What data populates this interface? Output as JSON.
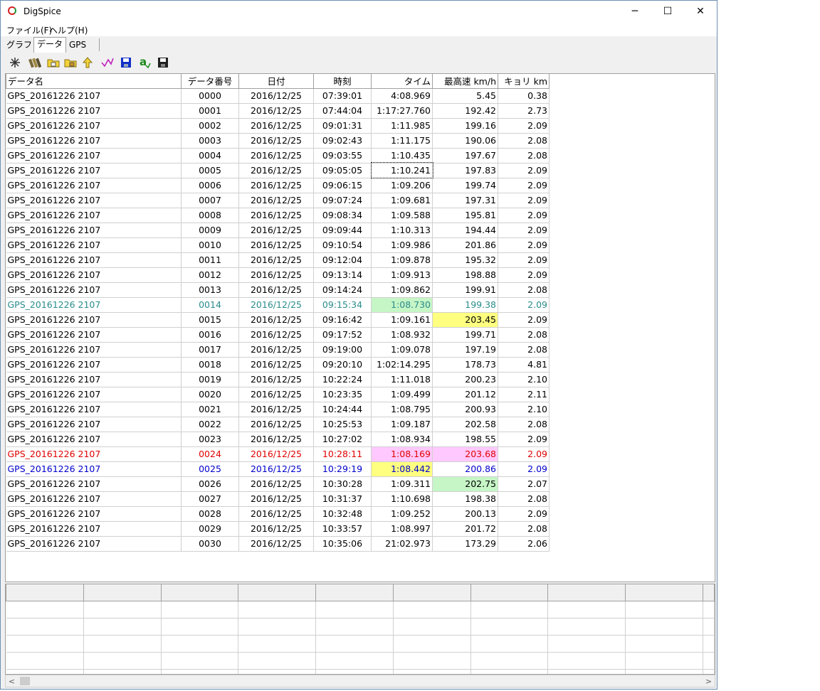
{
  "window": {
    "title": "DigSpice",
    "minimize": "─",
    "maximize": "☐",
    "close": "✕"
  },
  "menu": [
    {
      "label": "ファイル(F)"
    },
    {
      "label": "ヘルプ(H)"
    }
  ],
  "tabs": [
    {
      "label": "グラフ"
    },
    {
      "label": "データ"
    },
    {
      "label": "GPS"
    }
  ],
  "toolbar": [
    {
      "icon": "sparkle-icon"
    },
    {
      "icon": "books-icon"
    },
    {
      "icon": "folder-copy-icon"
    },
    {
      "icon": "folder-lock-icon"
    },
    {
      "icon": "up-arrow-icon"
    },
    {
      "icon": "chart-line-icon"
    },
    {
      "icon": "save-blue-icon"
    },
    {
      "icon": "text-a-icon"
    },
    {
      "icon": "save-black-icon"
    }
  ],
  "colors": {
    "teal": "#2a8c8c",
    "red": "#e00000",
    "blue": "#0000cc",
    "green_bg": "#c6f5c6",
    "yellow_bg": "#ffff80",
    "pink_bg": "#ffc8ff"
  },
  "table": {
    "headers": [
      "データ名",
      "データ番号",
      "日付",
      "時刻",
      "タイム",
      "最高速 km/h",
      "キョリ km"
    ],
    "rows": [
      {
        "name": "GPS_20161226 2107",
        "num": "0000",
        "date": "2016/12/25",
        "time": "07:39:01",
        "lap": "4:08.969",
        "speed": "5.45",
        "dist": "0.38"
      },
      {
        "name": "GPS_20161226 2107",
        "num": "0001",
        "date": "2016/12/25",
        "time": "07:44:04",
        "lap": "1:17:27.760",
        "speed": "192.42",
        "dist": "2.73"
      },
      {
        "name": "GPS_20161226 2107",
        "num": "0002",
        "date": "2016/12/25",
        "time": "09:01:31",
        "lap": "1:11.985",
        "speed": "199.16",
        "dist": "2.09"
      },
      {
        "name": "GPS_20161226 2107",
        "num": "0003",
        "date": "2016/12/25",
        "time": "09:02:43",
        "lap": "1:11.175",
        "speed": "190.06",
        "dist": "2.08"
      },
      {
        "name": "GPS_20161226 2107",
        "num": "0004",
        "date": "2016/12/25",
        "time": "09:03:55",
        "lap": "1:10.435",
        "speed": "197.67",
        "dist": "2.08"
      },
      {
        "name": "GPS_20161226 2107",
        "num": "0005",
        "date": "2016/12/25",
        "time": "09:05:05",
        "lap": "1:10.241",
        "speed": "197.83",
        "dist": "2.09",
        "lapFocus": true
      },
      {
        "name": "GPS_20161226 2107",
        "num": "0006",
        "date": "2016/12/25",
        "time": "09:06:15",
        "lap": "1:09.206",
        "speed": "199.74",
        "dist": "2.09"
      },
      {
        "name": "GPS_20161226 2107",
        "num": "0007",
        "date": "2016/12/25",
        "time": "09:07:24",
        "lap": "1:09.681",
        "speed": "197.31",
        "dist": "2.09"
      },
      {
        "name": "GPS_20161226 2107",
        "num": "0008",
        "date": "2016/12/25",
        "time": "09:08:34",
        "lap": "1:09.588",
        "speed": "195.81",
        "dist": "2.09"
      },
      {
        "name": "GPS_20161226 2107",
        "num": "0009",
        "date": "2016/12/25",
        "time": "09:09:44",
        "lap": "1:10.313",
        "speed": "194.44",
        "dist": "2.09"
      },
      {
        "name": "GPS_20161226 2107",
        "num": "0010",
        "date": "2016/12/25",
        "time": "09:10:54",
        "lap": "1:09.986",
        "speed": "201.86",
        "dist": "2.09"
      },
      {
        "name": "GPS_20161226 2107",
        "num": "0011",
        "date": "2016/12/25",
        "time": "09:12:04",
        "lap": "1:09.878",
        "speed": "195.32",
        "dist": "2.09"
      },
      {
        "name": "GPS_20161226 2107",
        "num": "0012",
        "date": "2016/12/25",
        "time": "09:13:14",
        "lap": "1:09.913",
        "speed": "198.88",
        "dist": "2.09"
      },
      {
        "name": "GPS_20161226 2107",
        "num": "0013",
        "date": "2016/12/25",
        "time": "09:14:24",
        "lap": "1:09.862",
        "speed": "199.91",
        "dist": "2.08"
      },
      {
        "name": "GPS_20161226 2107",
        "num": "0014",
        "date": "2016/12/25",
        "time": "09:15:34",
        "lap": "1:08.730",
        "speed": "199.38",
        "dist": "2.09",
        "text": "teal",
        "lapBg": "green_bg"
      },
      {
        "name": "GPS_20161226 2107",
        "num": "0015",
        "date": "2016/12/25",
        "time": "09:16:42",
        "lap": "1:09.161",
        "speed": "203.45",
        "dist": "2.09",
        "speedBg": "yellow_bg"
      },
      {
        "name": "GPS_20161226 2107",
        "num": "0016",
        "date": "2016/12/25",
        "time": "09:17:52",
        "lap": "1:08.932",
        "speed": "199.71",
        "dist": "2.08"
      },
      {
        "name": "GPS_20161226 2107",
        "num": "0017",
        "date": "2016/12/25",
        "time": "09:19:00",
        "lap": "1:09.078",
        "speed": "197.19",
        "dist": "2.08"
      },
      {
        "name": "GPS_20161226 2107",
        "num": "0018",
        "date": "2016/12/25",
        "time": "09:20:10",
        "lap": "1:02:14.295",
        "speed": "178.73",
        "dist": "4.81"
      },
      {
        "name": "GPS_20161226 2107",
        "num": "0019",
        "date": "2016/12/25",
        "time": "10:22:24",
        "lap": "1:11.018",
        "speed": "200.23",
        "dist": "2.10"
      },
      {
        "name": "GPS_20161226 2107",
        "num": "0020",
        "date": "2016/12/25",
        "time": "10:23:35",
        "lap": "1:09.499",
        "speed": "201.12",
        "dist": "2.11"
      },
      {
        "name": "GPS_20161226 2107",
        "num": "0021",
        "date": "2016/12/25",
        "time": "10:24:44",
        "lap": "1:08.795",
        "speed": "200.93",
        "dist": "2.10"
      },
      {
        "name": "GPS_20161226 2107",
        "num": "0022",
        "date": "2016/12/25",
        "time": "10:25:53",
        "lap": "1:09.187",
        "speed": "202.58",
        "dist": "2.08"
      },
      {
        "name": "GPS_20161226 2107",
        "num": "0023",
        "date": "2016/12/25",
        "time": "10:27:02",
        "lap": "1:08.934",
        "speed": "198.55",
        "dist": "2.09"
      },
      {
        "name": "GPS_20161226 2107",
        "num": "0024",
        "date": "2016/12/25",
        "time": "10:28:11",
        "lap": "1:08.169",
        "speed": "203.68",
        "dist": "2.09",
        "text": "red",
        "lapBg": "pink_bg",
        "speedBg": "pink_bg"
      },
      {
        "name": "GPS_20161226 2107",
        "num": "0025",
        "date": "2016/12/25",
        "time": "10:29:19",
        "lap": "1:08.442",
        "speed": "200.86",
        "dist": "2.09",
        "text": "blue",
        "lapBg": "yellow_bg"
      },
      {
        "name": "GPS_20161226 2107",
        "num": "0026",
        "date": "2016/12/25",
        "time": "10:30:28",
        "lap": "1:09.311",
        "speed": "202.75",
        "dist": "2.07",
        "speedBg": "green_bg"
      },
      {
        "name": "GPS_20161226 2107",
        "num": "0027",
        "date": "2016/12/25",
        "time": "10:31:37",
        "lap": "1:10.698",
        "speed": "198.38",
        "dist": "2.08"
      },
      {
        "name": "GPS_20161226 2107",
        "num": "0028",
        "date": "2016/12/25",
        "time": "10:32:48",
        "lap": "1:09.252",
        "speed": "200.13",
        "dist": "2.09"
      },
      {
        "name": "GPS_20161226 2107",
        "num": "0029",
        "date": "2016/12/25",
        "time": "10:33:57",
        "lap": "1:08.997",
        "speed": "201.72",
        "dist": "2.08"
      },
      {
        "name": "GPS_20161226 2107",
        "num": "0030",
        "date": "2016/12/25",
        "time": "10:35:06",
        "lap": "21:02.973",
        "speed": "173.29",
        "dist": "2.06"
      }
    ]
  },
  "scroll": {
    "left": "<",
    "right": ">"
  }
}
